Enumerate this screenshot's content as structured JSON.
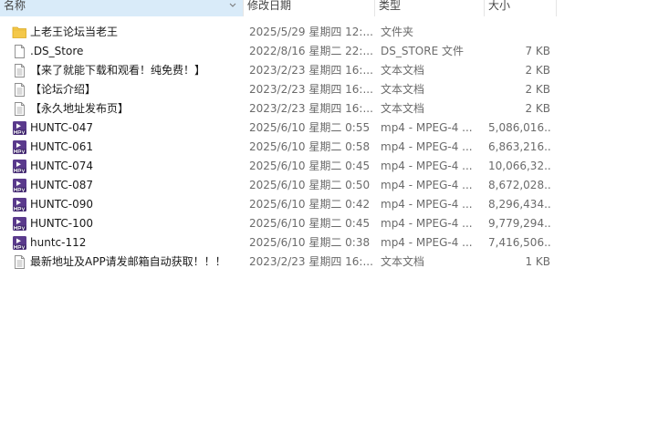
{
  "columns": {
    "name": "名称",
    "date": "修改日期",
    "type": "类型",
    "size": "大小"
  },
  "colors": {
    "folder": "#f4c84a",
    "mpv_purple": "#5a3a8c",
    "header_sorted": "#d9ebf9"
  },
  "files": [
    {
      "icon": "folder-icon",
      "name": "上老王论坛当老王",
      "date": "2025/5/29 星期四 12:...",
      "type": "文件夹",
      "size": ""
    },
    {
      "icon": "file-icon",
      "name": ".DS_Store",
      "date": "2022/8/16 星期二 22:...",
      "type": "DS_STORE 文件",
      "size": "7 KB"
    },
    {
      "icon": "text-file-icon",
      "name": "【来了就能下载和观看！纯免费！】",
      "date": "2023/2/23 星期四 16:...",
      "type": "文本文档",
      "size": "2 KB"
    },
    {
      "icon": "text-file-icon",
      "name": "【论坛介绍】",
      "date": "2023/2/23 星期四 16:...",
      "type": "文本文档",
      "size": "2 KB"
    },
    {
      "icon": "text-file-icon",
      "name": "【永久地址发布页】",
      "date": "2023/2/23 星期四 16:...",
      "type": "文本文档",
      "size": "2 KB"
    },
    {
      "icon": "mpv-video-icon",
      "name": "HUNTC-047",
      "date": "2025/6/10 星期二 0:55",
      "type": "mp4 - MPEG-4 ...",
      "size": "5,086,016..."
    },
    {
      "icon": "mpv-video-icon",
      "name": "HUNTC-061",
      "date": "2025/6/10 星期二 0:58",
      "type": "mp4 - MPEG-4 ...",
      "size": "6,863,216..."
    },
    {
      "icon": "mpv-video-icon",
      "name": "HUNTC-074",
      "date": "2025/6/10 星期二 0:45",
      "type": "mp4 - MPEG-4 ...",
      "size": "10,066,32..."
    },
    {
      "icon": "mpv-video-icon",
      "name": "HUNTC-087",
      "date": "2025/6/10 星期二 0:50",
      "type": "mp4 - MPEG-4 ...",
      "size": "8,672,028..."
    },
    {
      "icon": "mpv-video-icon",
      "name": "HUNTC-090",
      "date": "2025/6/10 星期二 0:42",
      "type": "mp4 - MPEG-4 ...",
      "size": "8,296,434..."
    },
    {
      "icon": "mpv-video-icon",
      "name": "HUNTC-100",
      "date": "2025/6/10 星期二 0:45",
      "type": "mp4 - MPEG-4 ...",
      "size": "9,779,294..."
    },
    {
      "icon": "mpv-video-icon",
      "name": "huntc-112",
      "date": "2025/6/10 星期二 0:38",
      "type": "mp4 - MPEG-4 ...",
      "size": "7,416,506..."
    },
    {
      "icon": "text-file-icon",
      "name": "最新地址及APP请发邮箱自动获取！！！",
      "date": "2023/2/23 星期四 16:...",
      "type": "文本文档",
      "size": "1 KB"
    }
  ]
}
